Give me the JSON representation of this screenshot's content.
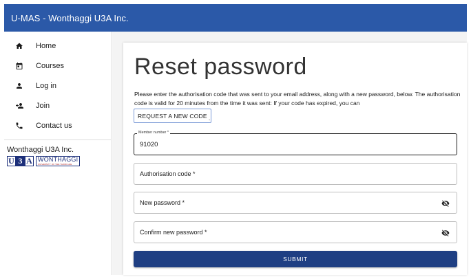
{
  "app": {
    "title": "U-MAS - Wonthaggi U3A Inc."
  },
  "sidebar": {
    "items": [
      {
        "label": "Home",
        "icon": "home-icon"
      },
      {
        "label": "Courses",
        "icon": "calendar-icon"
      },
      {
        "label": "Log in",
        "icon": "person-icon"
      },
      {
        "label": "Join",
        "icon": "add-person-icon"
      },
      {
        "label": "Contact us",
        "icon": "phone-icon"
      }
    ],
    "org_name": "Wonthaggi U3A Inc.",
    "logo": {
      "letters": [
        "U",
        "3",
        "A"
      ],
      "wordmark": "WONTHAGGI",
      "tagline": "UNIVERSITY OF THE THIRD AGE"
    }
  },
  "form": {
    "title": "Reset password",
    "instructions": "Please enter the authorisation code that was sent to your email address, along with a new password, below. The authorisation code is valid for 20 minutes from the time it was sent: If your code has expired, you can",
    "request_code_label": "REQUEST A NEW CODE",
    "request_code_suffix": ".",
    "member_number": {
      "label": "Member number *",
      "value": "91020"
    },
    "auth_code": {
      "placeholder": "Authorisation code *"
    },
    "new_password": {
      "placeholder": "New password *"
    },
    "confirm_password": {
      "placeholder": "Confirm new password *"
    },
    "submit_label": "SUBMIT"
  },
  "colors": {
    "appbar": "#2b59a8",
    "submit": "#1f3f83",
    "logo": "#1c2f7a"
  }
}
